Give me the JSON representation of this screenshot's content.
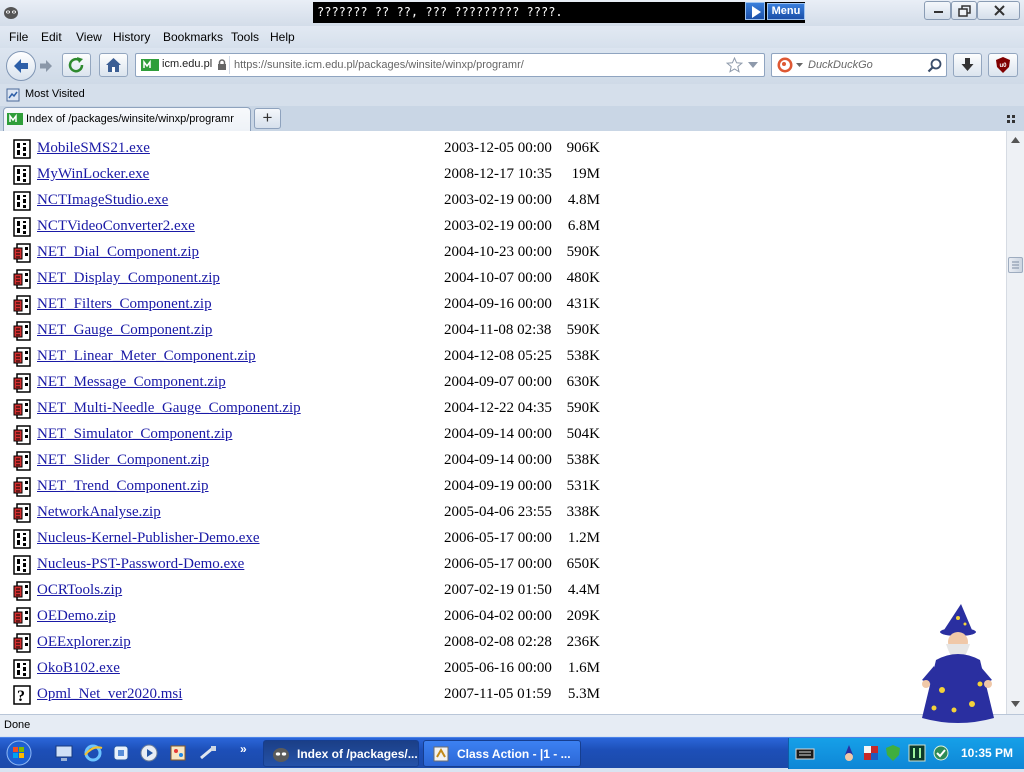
{
  "window": {
    "title": "??????? ?? ??, ??? ????????? ????.",
    "menu_button": "Menu"
  },
  "menubar": {
    "items": [
      {
        "label": "File",
        "name": "menu-file"
      },
      {
        "label": "Edit",
        "name": "menu-edit"
      },
      {
        "label": "View",
        "name": "menu-view"
      },
      {
        "label": "History",
        "name": "menu-history"
      },
      {
        "label": "Bookmarks",
        "name": "menu-bookmarks"
      },
      {
        "label": "Tools",
        "name": "menu-tools"
      },
      {
        "label": "Help",
        "name": "menu-help"
      }
    ]
  },
  "navbar": {
    "site_identity": "icm.edu.pl",
    "url": "https://sunsite.icm.edu.pl/packages/winsite/winxp/programr/",
    "search_placeholder": "DuckDuckGo"
  },
  "bookmarks": {
    "most_visited": "Most Visited"
  },
  "tab": {
    "label": "Index of /packages/winsite/winxp/programr"
  },
  "files": [
    {
      "name": "MobileSMS21.exe",
      "date": "2003-12-05 00:00",
      "size": "906K",
      "icon": "binary-icon"
    },
    {
      "name": "MyWinLocker.exe",
      "date": "2008-12-17 10:35",
      "size": "19M",
      "icon": "binary-icon"
    },
    {
      "name": "NCTImageStudio.exe",
      "date": "2003-02-19 00:00",
      "size": "4.8M",
      "icon": "binary-icon"
    },
    {
      "name": "NCTVideoConverter2.exe",
      "date": "2003-02-19 00:00",
      "size": "6.8M",
      "icon": "binary-icon"
    },
    {
      "name": "NET_Dial_Component.zip",
      "date": "2004-10-23 00:00",
      "size": "590K",
      "icon": "compressed-icon"
    },
    {
      "name": "NET_Display_Component.zip",
      "date": "2004-10-07 00:00",
      "size": "480K",
      "icon": "compressed-icon"
    },
    {
      "name": "NET_Filters_Component.zip",
      "date": "2004-09-16 00:00",
      "size": "431K",
      "icon": "compressed-icon"
    },
    {
      "name": "NET_Gauge_Component.zip",
      "date": "2004-11-08 02:38",
      "size": "590K",
      "icon": "compressed-icon"
    },
    {
      "name": "NET_Linear_Meter_Component.zip",
      "date": "2004-12-08 05:25",
      "size": "538K",
      "icon": "compressed-icon"
    },
    {
      "name": "NET_Message_Component.zip",
      "date": "2004-09-07 00:00",
      "size": "630K",
      "icon": "compressed-icon"
    },
    {
      "name": "NET_Multi-Needle_Gauge_Component.zip",
      "date": "2004-12-22 04:35",
      "size": "590K",
      "icon": "compressed-icon"
    },
    {
      "name": "NET_Simulator_Component.zip",
      "date": "2004-09-14 00:00",
      "size": "504K",
      "icon": "compressed-icon"
    },
    {
      "name": "NET_Slider_Component.zip",
      "date": "2004-09-14 00:00",
      "size": "538K",
      "icon": "compressed-icon"
    },
    {
      "name": "NET_Trend_Component.zip",
      "date": "2004-09-19 00:00",
      "size": "531K",
      "icon": "compressed-icon"
    },
    {
      "name": "NetworkAnalyse.zip",
      "date": "2005-04-06 23:55",
      "size": "338K",
      "icon": "compressed-icon"
    },
    {
      "name": "Nucleus-Kernel-Publisher-Demo.exe",
      "date": "2006-05-17 00:00",
      "size": "1.2M",
      "icon": "binary-icon"
    },
    {
      "name": "Nucleus-PST-Password-Demo.exe",
      "date": "2006-05-17 00:00",
      "size": "650K",
      "icon": "binary-icon"
    },
    {
      "name": "OCRTools.zip",
      "date": "2007-02-19 01:50",
      "size": "4.4M",
      "icon": "compressed-icon"
    },
    {
      "name": "OEDemo.zip",
      "date": "2006-04-02 00:00",
      "size": "209K",
      "icon": "compressed-icon"
    },
    {
      "name": "OEExplorer.zip",
      "date": "2008-02-08 02:28",
      "size": "236K",
      "icon": "compressed-icon"
    },
    {
      "name": "OkoB102.exe",
      "date": "2005-06-16 00:00",
      "size": "1.6M",
      "icon": "binary-icon"
    },
    {
      "name": "Opml_Net_ver2020.msi",
      "date": "2007-11-05 01:59",
      "size": "5.3M",
      "icon": "unknown-icon"
    }
  ],
  "status": {
    "text": "Done"
  },
  "taskbar": {
    "tasks": [
      {
        "label": "Index of /packages/..."
      },
      {
        "label": "Class Action - |1 - ..."
      }
    ],
    "clock": "10:35 PM"
  },
  "colors": {
    "link": "#1a1aa6",
    "taskbar": "#2b66d9",
    "tray": "#16a0e8",
    "title_box": "#000000"
  }
}
